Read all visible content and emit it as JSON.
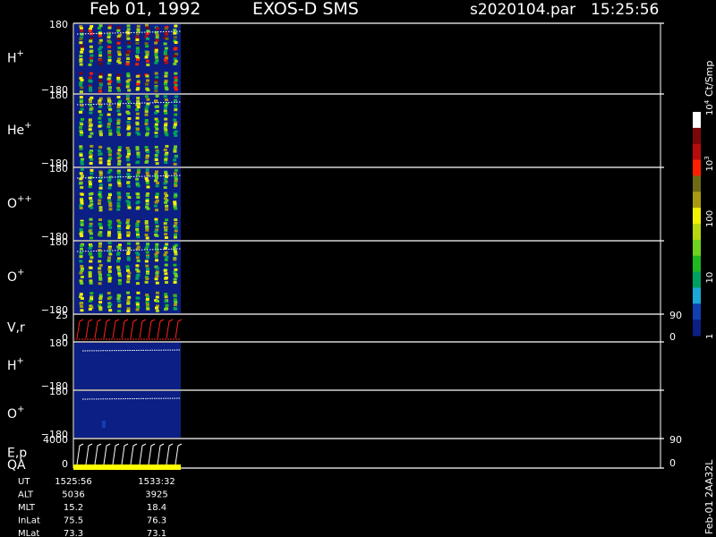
{
  "header": {
    "date": "Feb 01, 1992",
    "instrument": "EXOS-D SMS",
    "file": "s2020104.par",
    "time": "15:25:56"
  },
  "colorbar": {
    "title": "Ct/Smp",
    "ticks": [
      {
        "label": "1",
        "value": 1
      },
      {
        "label": "10",
        "value": 10
      },
      {
        "label": "100",
        "value": 100
      },
      {
        "label": "10^3",
        "value": 1000
      },
      {
        "label": "10^4",
        "value": 10000
      }
    ],
    "colors": [
      "#0b1f84",
      "#123fb0",
      "#1aa8d8",
      "#00a060",
      "#1fb81f",
      "#6ed21f",
      "#b8d80e",
      "#f2f200",
      "#a89a10",
      "#6e6a14",
      "#ff1f00",
      "#b80c0c",
      "#7a0808",
      "#ffffff"
    ]
  },
  "side_labels": {
    "footer": "Feb-01 2AA32L"
  },
  "chart_data": {
    "type": "heatmap",
    "time_range": [
      "1525:56",
      "1533:32"
    ],
    "panels": [
      {
        "id": "h-plus",
        "species": "H",
        "charge": "+",
        "ylim": [
          -180,
          180
        ],
        "yticks": [
          "180",
          "−180"
        ],
        "kind": "spectrogram"
      },
      {
        "id": "he-plus",
        "species": "He",
        "charge": "+",
        "ylim": [
          -180,
          180
        ],
        "yticks": [
          "180",
          "−180"
        ],
        "kind": "spectrogram"
      },
      {
        "id": "o-plusplus",
        "species": "O",
        "charge": "++",
        "ylim": [
          -180,
          180
        ],
        "yticks": [
          "180",
          "−180"
        ],
        "kind": "spectrogram"
      },
      {
        "id": "o-plus",
        "species": "O",
        "charge": "+",
        "ylim": [
          -180,
          180
        ],
        "yticks": [
          "180",
          "−180"
        ],
        "kind": "spectrogram"
      },
      {
        "id": "vr",
        "label": "V,r",
        "ylim": [
          0,
          25
        ],
        "yticks": [
          "25",
          "0"
        ],
        "right_ticks": [
          "90",
          "0"
        ],
        "kind": "line"
      },
      {
        "id": "h-plus-2",
        "species": "H",
        "charge": "+",
        "ylim": [
          -180,
          180
        ],
        "yticks": [
          "180",
          "−180"
        ],
        "kind": "empty"
      },
      {
        "id": "o-plus-2",
        "species": "O",
        "charge": "+",
        "ylim": [
          -180,
          180
        ],
        "yticks": [
          "180",
          "−180"
        ],
        "kind": "empty"
      },
      {
        "id": "ep",
        "label": "E,p",
        "ylim": [
          0,
          4000
        ],
        "yticks": [
          "4000",
          "0"
        ],
        "right_ticks": [
          "90",
          "0"
        ],
        "kind": "line"
      }
    ],
    "qa_label": "QA",
    "ephemeris": [
      {
        "label": "UT",
        "values": [
          "1525:56",
          "1533:32"
        ]
      },
      {
        "label": "ALT",
        "values": [
          "5036",
          "3925"
        ]
      },
      {
        "label": "MLT",
        "values": [
          "15.2",
          "18.4"
        ]
      },
      {
        "label": "InLat",
        "values": [
          "75.5",
          "76.3"
        ]
      },
      {
        "label": "MLat",
        "values": [
          "73.3",
          "73.1"
        ]
      }
    ]
  }
}
